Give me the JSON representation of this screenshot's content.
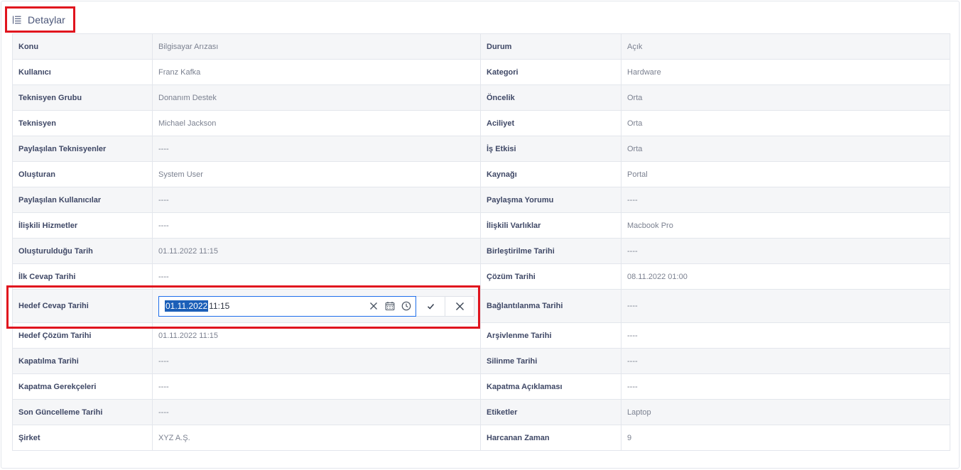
{
  "header": {
    "title": "Detaylar",
    "icon": "list-icon"
  },
  "rows": [
    [
      {
        "label": "Konu",
        "value": "Bilgisayar Arızası"
      },
      {
        "label": "Durum",
        "value": "Açık"
      }
    ],
    [
      {
        "label": "Kullanıcı",
        "value": "Franz Kafka"
      },
      {
        "label": "Kategori",
        "value": "Hardware"
      }
    ],
    [
      {
        "label": "Teknisyen Grubu",
        "value": "Donanım Destek"
      },
      {
        "label": "Öncelik",
        "value": "Orta"
      }
    ],
    [
      {
        "label": "Teknisyen",
        "value": "Michael Jackson"
      },
      {
        "label": "Aciliyet",
        "value": "Orta"
      }
    ],
    [
      {
        "label": "Paylaşılan Teknisyenler",
        "value": "----"
      },
      {
        "label": "İş Etkisi",
        "value": "Orta"
      }
    ],
    [
      {
        "label": "Oluşturan",
        "value": "System User"
      },
      {
        "label": "Kaynağı",
        "value": "Portal"
      }
    ],
    [
      {
        "label": "Paylaşılan Kullanıcılar",
        "value": "----"
      },
      {
        "label": "Paylaşma Yorumu",
        "value": "----"
      }
    ],
    [
      {
        "label": "İlişkili Hizmetler",
        "value": "----"
      },
      {
        "label": "İlişkili Varlıklar",
        "value": "Macbook Pro"
      }
    ],
    [
      {
        "label": "Oluşturulduğu Tarih",
        "value": "01.11.2022 11:15"
      },
      {
        "label": "Birleştirilme Tarihi",
        "value": "----"
      }
    ],
    [
      {
        "label": "İlk Cevap Tarihi",
        "value": "----"
      },
      {
        "label": "Çözüm Tarihi",
        "value": "08.11.2022 01:00"
      }
    ],
    [
      {
        "label": "Hedef Cevap Tarihi",
        "value": ""
      },
      {
        "label": "Bağlantılanma Tarihi",
        "value": "----"
      }
    ],
    [
      {
        "label": "Hedef Çözüm Tarihi",
        "value": "01.11.2022 11:15"
      },
      {
        "label": "Arşivlenme Tarihi",
        "value": "----"
      }
    ],
    [
      {
        "label": "Kapatılma Tarihi",
        "value": "----"
      },
      {
        "label": "Silinme Tarihi",
        "value": "----"
      }
    ],
    [
      {
        "label": "Kapatma Gerekçeleri",
        "value": "----"
      },
      {
        "label": "Kapatma Açıklaması",
        "value": "----"
      }
    ],
    [
      {
        "label": "Son Güncelleme Tarihi",
        "value": "----"
      },
      {
        "label": "Etiketler",
        "value": "Laptop"
      }
    ],
    [
      {
        "label": "Şirket",
        "value": "XYZ A.Ş."
      },
      {
        "label": "Harcanan Zaman",
        "value": "9"
      }
    ]
  ],
  "editor": {
    "selected_text": "01.11.2022",
    "rest_text": "11:15",
    "icons": [
      "clear-icon",
      "calendar-icon",
      "clock-icon"
    ],
    "confirm_icon": "check-icon",
    "cancel_icon": "close-icon"
  },
  "colors": {
    "highlight": "#e0141e",
    "input_focus": "#1f6feb",
    "selection": "#1b5fb8",
    "label": "#3f4866"
  }
}
